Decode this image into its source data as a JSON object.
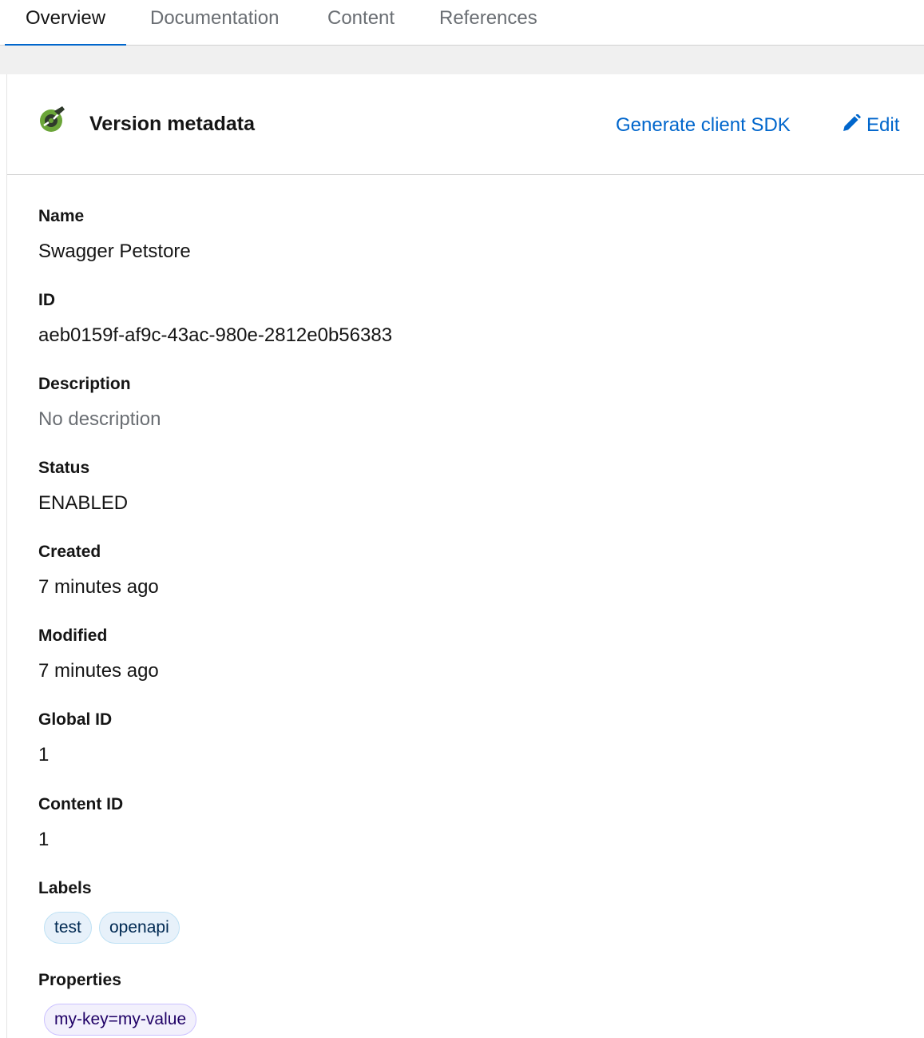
{
  "tabs": [
    {
      "label": "Overview",
      "active": true
    },
    {
      "label": "Documentation",
      "active": false
    },
    {
      "label": "Content",
      "active": false
    },
    {
      "label": "References",
      "active": false
    }
  ],
  "card": {
    "title": "Version metadata",
    "title_icon": "openapi-logo-icon",
    "actions": {
      "generate_sdk": "Generate client SDK",
      "edit": "Edit"
    }
  },
  "fields": {
    "name": {
      "label": "Name",
      "value": "Swagger Petstore"
    },
    "id": {
      "label": "ID",
      "value": "aeb0159f-af9c-43ac-980e-2812e0b56383"
    },
    "description": {
      "label": "Description",
      "value": "No description"
    },
    "status": {
      "label": "Status",
      "value": "ENABLED"
    },
    "created": {
      "label": "Created",
      "value": "7 minutes ago"
    },
    "modified": {
      "label": "Modified",
      "value": "7 minutes ago"
    },
    "global_id": {
      "label": "Global ID",
      "value": "1"
    },
    "content_id": {
      "label": "Content ID",
      "value": "1"
    },
    "labels": {
      "label": "Labels",
      "items": [
        "test",
        "openapi"
      ]
    },
    "properties": {
      "label": "Properties",
      "items": [
        "my-key=my-value"
      ]
    }
  },
  "colors": {
    "accent": "#0066cc",
    "label_chip_bg": "#e7f1fa",
    "property_chip_bg": "#f2f0fc"
  }
}
